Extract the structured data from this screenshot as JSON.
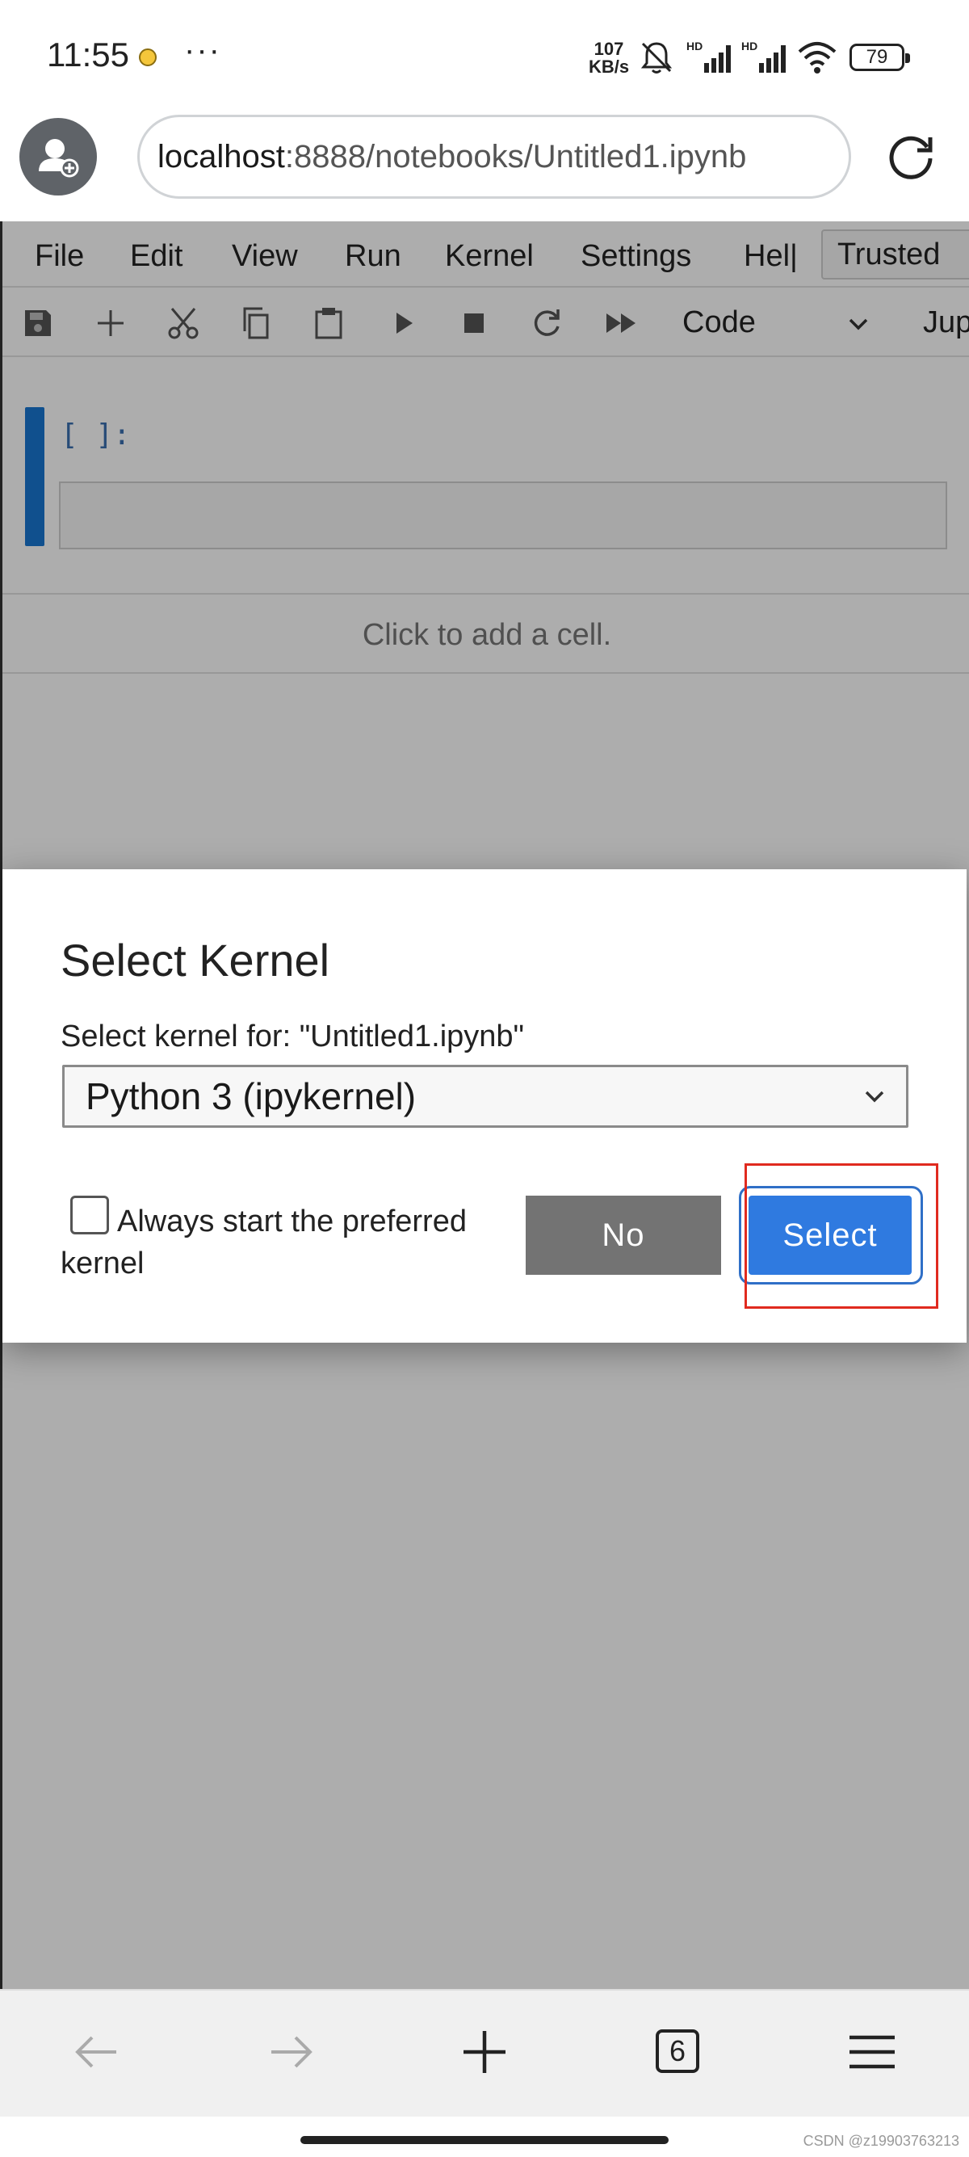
{
  "status_bar": {
    "time": "11:55",
    "dots": "···",
    "network_speed_value": "107",
    "network_speed_unit": "KB/s",
    "battery_level": "79",
    "icons": [
      "emoji-icon",
      "bell-muted-icon",
      "hd-signal-icon",
      "hd-signal-icon",
      "wifi-icon",
      "battery-icon"
    ]
  },
  "browser": {
    "url_host": "localhost",
    "url_path": ":8888/notebooks/Untitled1.ipynb"
  },
  "menu": {
    "items": [
      "File",
      "Edit",
      "View",
      "Run",
      "Kernel",
      "Settings",
      "Hel|"
    ],
    "trusted_label": "Trusted"
  },
  "toolbar": {
    "icons": [
      "save-icon",
      "add-icon",
      "cut-icon",
      "copy-icon",
      "paste-icon",
      "run-icon",
      "stop-icon",
      "restart-icon",
      "fast-forward-icon"
    ],
    "cell_type": "Code",
    "kernel_name": "Jup"
  },
  "notebook": {
    "cell_prompt": "[ ]:",
    "add_cell_text": "Click to add a cell."
  },
  "dialog": {
    "title": "Select Kernel",
    "label": "Select kernel for: \"Untitled1.ipynb\"",
    "selected_kernel": "Python 3 (ipykernel)",
    "checkbox_label": "Always start the preferred kernel",
    "checkbox_checked": false,
    "no_label": "No",
    "select_label": "Select"
  },
  "bottom_nav": {
    "tabs_count": "6",
    "icons": [
      "back-arrow-icon",
      "forward-arrow-icon",
      "new-tab-icon",
      "tabs-icon",
      "menu-icon"
    ]
  },
  "watermark": "CSDN @z19903763213",
  "colors": {
    "accent": "#2f7ae0",
    "highlight": "#e02a1f",
    "cell_selection": "#1976d2"
  }
}
